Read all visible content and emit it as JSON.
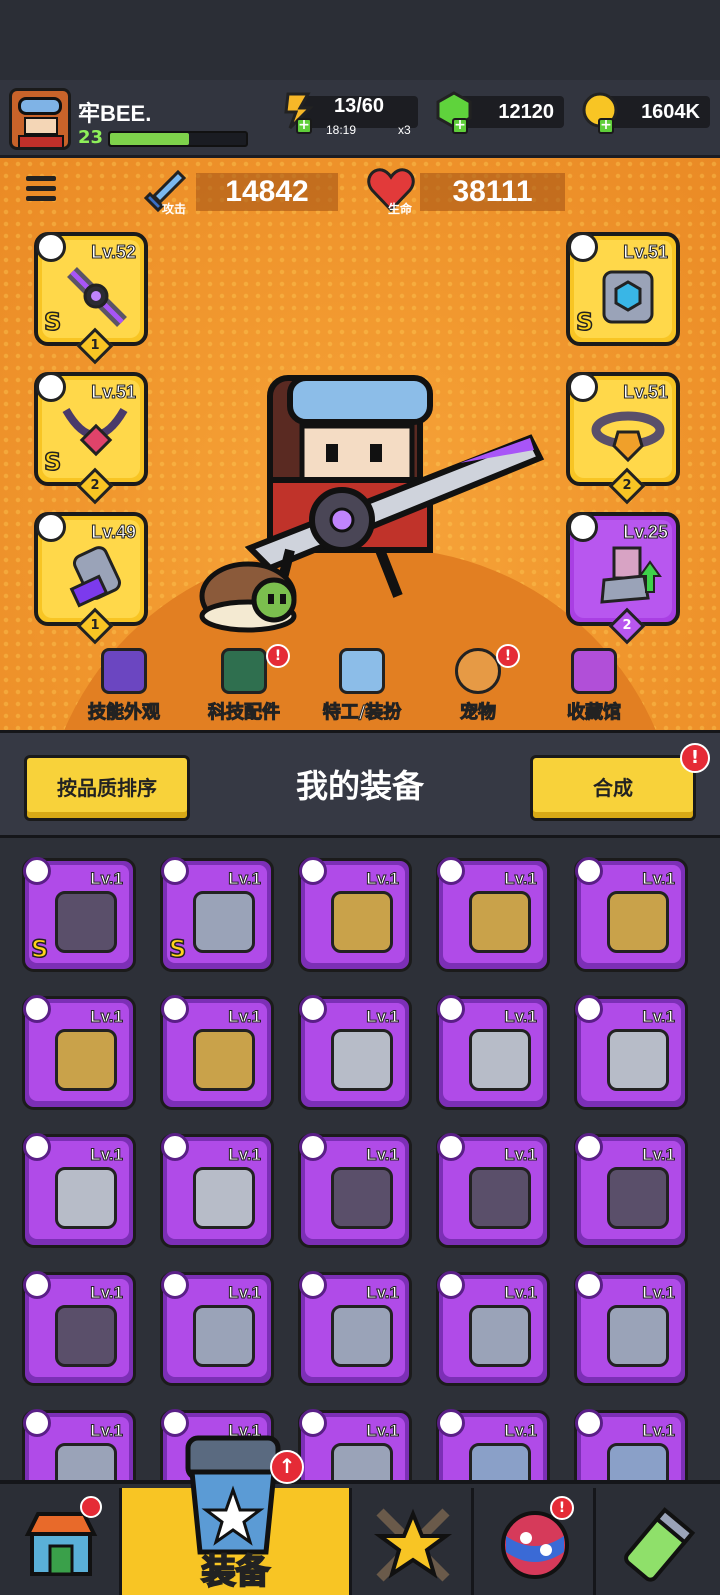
{
  "player": {
    "name": "牢BEE.",
    "level": "23",
    "xp_fraction": 0.58
  },
  "resources": {
    "energy": {
      "value": "13/60",
      "timer": "18:19",
      "multiplier": "x3"
    },
    "gems": {
      "value": "12120"
    },
    "gold": {
      "value": "1604K"
    }
  },
  "stats": {
    "attack": {
      "label": "攻击",
      "value": "14842"
    },
    "health": {
      "label": "生命",
      "value": "38111"
    }
  },
  "equipped_left": [
    {
      "level": "Lv.52",
      "grade": "S",
      "count": "1",
      "type": "weapon-icon"
    },
    {
      "level": "Lv.51",
      "grade": "S",
      "count": "2",
      "type": "necklace-icon"
    },
    {
      "level": "Lv.49",
      "grade": "",
      "count": "1",
      "type": "glove-icon"
    }
  ],
  "equipped_right": [
    {
      "level": "Lv.51",
      "grade": "S",
      "count": "",
      "type": "armor-icon"
    },
    {
      "level": "Lv.51",
      "grade": "",
      "count": "2",
      "type": "belt-icon"
    },
    {
      "level": "Lv.25",
      "grade": "",
      "count": "2",
      "type": "boot-icon"
    }
  ],
  "feature_nav": [
    {
      "label": "技能外观",
      "badge": false
    },
    {
      "label": "科技配件",
      "badge": true
    },
    {
      "label": "特工/装扮",
      "badge": false
    },
    {
      "label": "宠物",
      "badge": true
    },
    {
      "label": "收藏馆",
      "badge": false
    }
  ],
  "panel": {
    "sort_label": "按品质排序",
    "title": "我的装备",
    "merge_label": "合成",
    "badge": "!"
  },
  "inventory": [
    {
      "level": "Lv.1",
      "grade": "S",
      "type": "necklace-icon"
    },
    {
      "level": "Lv.1",
      "grade": "S",
      "type": "belt-icon"
    },
    {
      "level": "Lv.1",
      "grade": "",
      "type": "weapon-icon"
    },
    {
      "level": "Lv.1",
      "grade": "",
      "type": "weapon-icon"
    },
    {
      "level": "Lv.1",
      "grade": "",
      "type": "weapon-icon"
    },
    {
      "level": "Lv.1",
      "grade": "",
      "type": "weapon-icon"
    },
    {
      "level": "Lv.1",
      "grade": "",
      "type": "weapon-icon"
    },
    {
      "level": "Lv.1",
      "grade": "",
      "type": "armor-icon"
    },
    {
      "level": "Lv.1",
      "grade": "",
      "type": "armor-icon"
    },
    {
      "level": "Lv.1",
      "grade": "",
      "type": "armor-icon"
    },
    {
      "level": "Lv.1",
      "grade": "",
      "type": "armor-icon"
    },
    {
      "level": "Lv.1",
      "grade": "",
      "type": "armor-icon"
    },
    {
      "level": "Lv.1",
      "grade": "",
      "type": "necklace-icon"
    },
    {
      "level": "Lv.1",
      "grade": "",
      "type": "necklace-icon"
    },
    {
      "level": "Lv.1",
      "grade": "",
      "type": "necklace-icon"
    },
    {
      "level": "Lv.1",
      "grade": "",
      "type": "necklace-icon"
    },
    {
      "level": "Lv.1",
      "grade": "",
      "type": "belt-icon"
    },
    {
      "level": "Lv.1",
      "grade": "",
      "type": "belt-icon"
    },
    {
      "level": "Lv.1",
      "grade": "",
      "type": "belt-icon"
    },
    {
      "level": "Lv.1",
      "grade": "",
      "type": "belt-icon"
    },
    {
      "level": "Lv.1",
      "grade": "",
      "type": "belt-icon"
    },
    {
      "level": "Lv.1",
      "grade": "",
      "type": "belt-icon"
    },
    {
      "level": "Lv.1",
      "grade": "",
      "type": "belt-icon"
    },
    {
      "level": "Lv.1",
      "grade": "",
      "type": "glove-icon"
    },
    {
      "level": "Lv.1",
      "grade": "",
      "type": "glove-icon"
    }
  ],
  "bottom_nav": [
    {
      "label": "",
      "icon": "shop-icon",
      "badge": true
    },
    {
      "label": "装备",
      "icon": "equipment-icon",
      "badge": true,
      "active": true
    },
    {
      "label": "",
      "icon": "battle-icon",
      "badge": false
    },
    {
      "label": "",
      "icon": "world-icon",
      "badge": true
    },
    {
      "label": "",
      "icon": "lab-icon",
      "badge": false
    }
  ],
  "colors": {
    "accent_yellow": "#f8c524",
    "item_purple": "#b04be8",
    "hero_orange": "#f29a30"
  }
}
